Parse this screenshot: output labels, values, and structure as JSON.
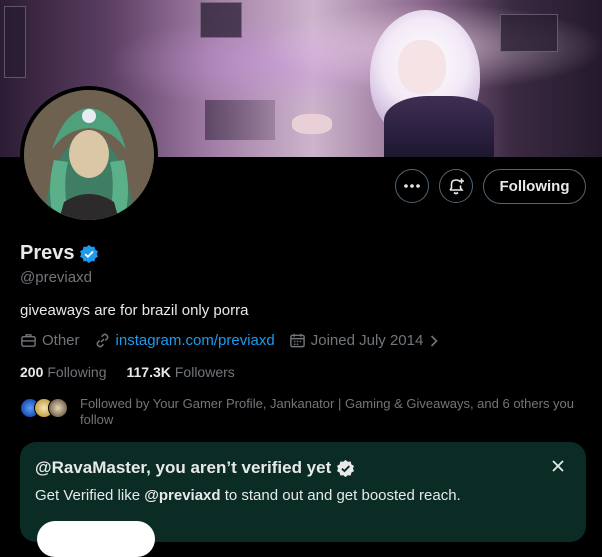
{
  "profile": {
    "name": "Prevs",
    "handle": "@previaxd",
    "bio": "giveaways are for brazil only porra",
    "category": "Other",
    "website": "instagram.com/previaxd",
    "joined": "Joined July 2014",
    "following_count": "200",
    "following_label": "Following",
    "followers_count": "117.3K",
    "followers_label": "Followers",
    "followed_by": "Followed by Your Gamer Profile, Jankanator | Gaming & Giveaways, and 6 others you follow"
  },
  "actions": {
    "follow_state": "Following",
    "more_icon": "more-icon",
    "notify_icon": "bell-plus-icon"
  },
  "verify_card": {
    "title": "@RavaMaster, you aren’t verified yet",
    "subtitle_prefix": "Get Verified like ",
    "subtitle_handle": "@previaxd",
    "subtitle_suffix": " to stand out and get boosted reach."
  },
  "colors": {
    "accent": "#1d9bf0",
    "card_bg": "#0b2c24",
    "muted": "#71767b"
  }
}
